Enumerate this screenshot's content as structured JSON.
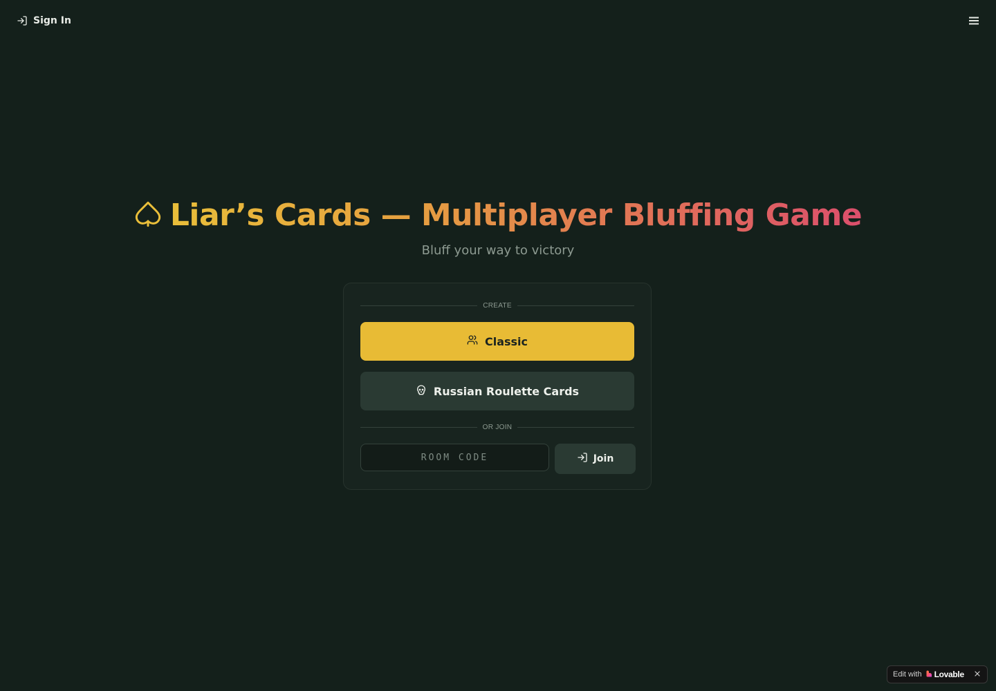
{
  "header": {
    "signin_label": "Sign In",
    "signin_icon": "log-in-icon",
    "menu_icon": "hamburger-menu-icon"
  },
  "hero": {
    "icon": "spade-icon",
    "title": "Liar’s Cards — Multiplayer Bluffing Game",
    "subtitle": "Bluff your way to victory"
  },
  "lobby": {
    "create_label": "CREATE",
    "classic_label": "Classic",
    "classic_icon": "users-icon",
    "roulette_label": "Russian Roulette Cards",
    "roulette_icon": "skull-icon",
    "join_divider_label": "OR JOIN",
    "room_code_placeholder": "ROOM CODE",
    "room_code_value": "",
    "join_label": "Join",
    "join_icon": "log-in-icon"
  },
  "badge": {
    "edit_label": "Edit with",
    "brand_label": "Lovable",
    "close_icon": "close-icon"
  },
  "colors": {
    "background": "#14201b",
    "card": "#18241f",
    "accent": "#e8bb35",
    "secondary_button": "#2a3a33",
    "gradient_start": "#e9be3a",
    "gradient_end": "#dc4f6c"
  }
}
